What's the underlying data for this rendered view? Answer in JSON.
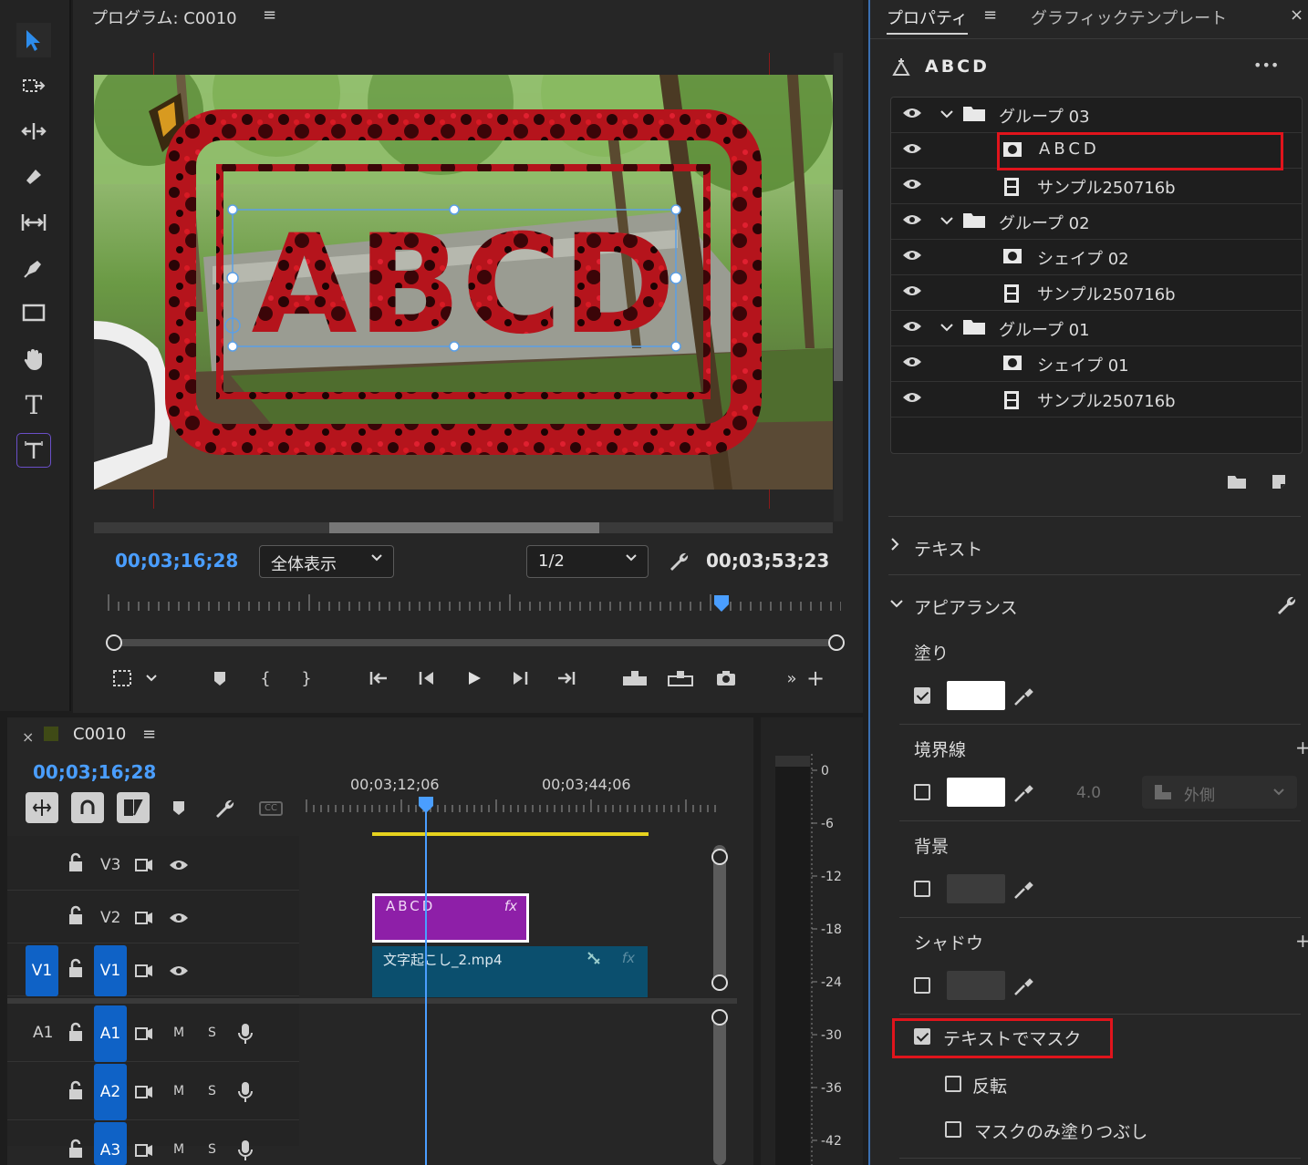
{
  "program": {
    "title": "プログラム: C0010",
    "menu": "≡",
    "timecode": "00;03;16;28",
    "fit": "全体表示",
    "resolution": "1/2",
    "duration": "00;03;53;23",
    "video_text": "ABCD"
  },
  "properties": {
    "tabs": [
      "プロパティ",
      "グラフィックテンプレート"
    ],
    "menu": "≡",
    "close": "×",
    "selected_layer": "ABCD",
    "more": "•••",
    "layers": [
      {
        "name": "グループ 03",
        "type": "group"
      },
      {
        "name": "ABCD",
        "type": "text"
      },
      {
        "name": "サンプル250716b",
        "type": "clip"
      },
      {
        "name": "グループ 02",
        "type": "group"
      },
      {
        "name": "シェイプ 02",
        "type": "shape"
      },
      {
        "name": "サンプル250716b",
        "type": "clip"
      },
      {
        "name": "グループ 01",
        "type": "group"
      },
      {
        "name": "シェイプ 01",
        "type": "shape"
      },
      {
        "name": "サンプル250716b",
        "type": "clip"
      }
    ],
    "sections": {
      "text": "テキスト",
      "appearance": "アピアランス"
    },
    "fill": {
      "label": "塗り",
      "checked": true,
      "color": "#ffffff"
    },
    "stroke": {
      "label": "境界線",
      "checked": false,
      "color": "#ffffff",
      "width": "4.0",
      "position": "外側"
    },
    "background": {
      "label": "背景",
      "checked": false
    },
    "shadow": {
      "label": "シャドウ",
      "checked": false
    },
    "mask": {
      "label": "テキストでマスク",
      "checked": true
    },
    "invert": {
      "label": "反転",
      "checked": false
    },
    "mask_only": {
      "label": "マスクのみ塗りつぶし",
      "checked": false
    }
  },
  "timeline": {
    "close": "×",
    "sequence": "C0010",
    "menu": "≡",
    "timecode": "00;03;16;28",
    "ruler": [
      "00;03;12;06",
      "00;03;44;06"
    ],
    "video_tracks": [
      {
        "name": "V3"
      },
      {
        "name": "V2"
      },
      {
        "name": "V1",
        "source": "V1"
      }
    ],
    "audio_tracks": [
      {
        "name": "A1",
        "source": "A1"
      },
      {
        "name": "A2"
      },
      {
        "name": "A3"
      }
    ],
    "track_buttons": {
      "mute": "M",
      "solo": "S"
    },
    "clips": {
      "graphic": "ABCD",
      "video": "文字起こし_2.mp4",
      "fx": "fx"
    }
  },
  "meter": {
    "scale": [
      "0",
      "-6",
      "-12",
      "-18",
      "-24",
      "-30",
      "-36",
      "-42"
    ]
  },
  "colors": {
    "accent": "#4a9eff",
    "track_active": "#0f62c6",
    "graphic_clip": "#8e1fa8",
    "video_clip": "#0b4f6e",
    "highlight": "#e0141c",
    "work_area": "#e6d21e"
  }
}
